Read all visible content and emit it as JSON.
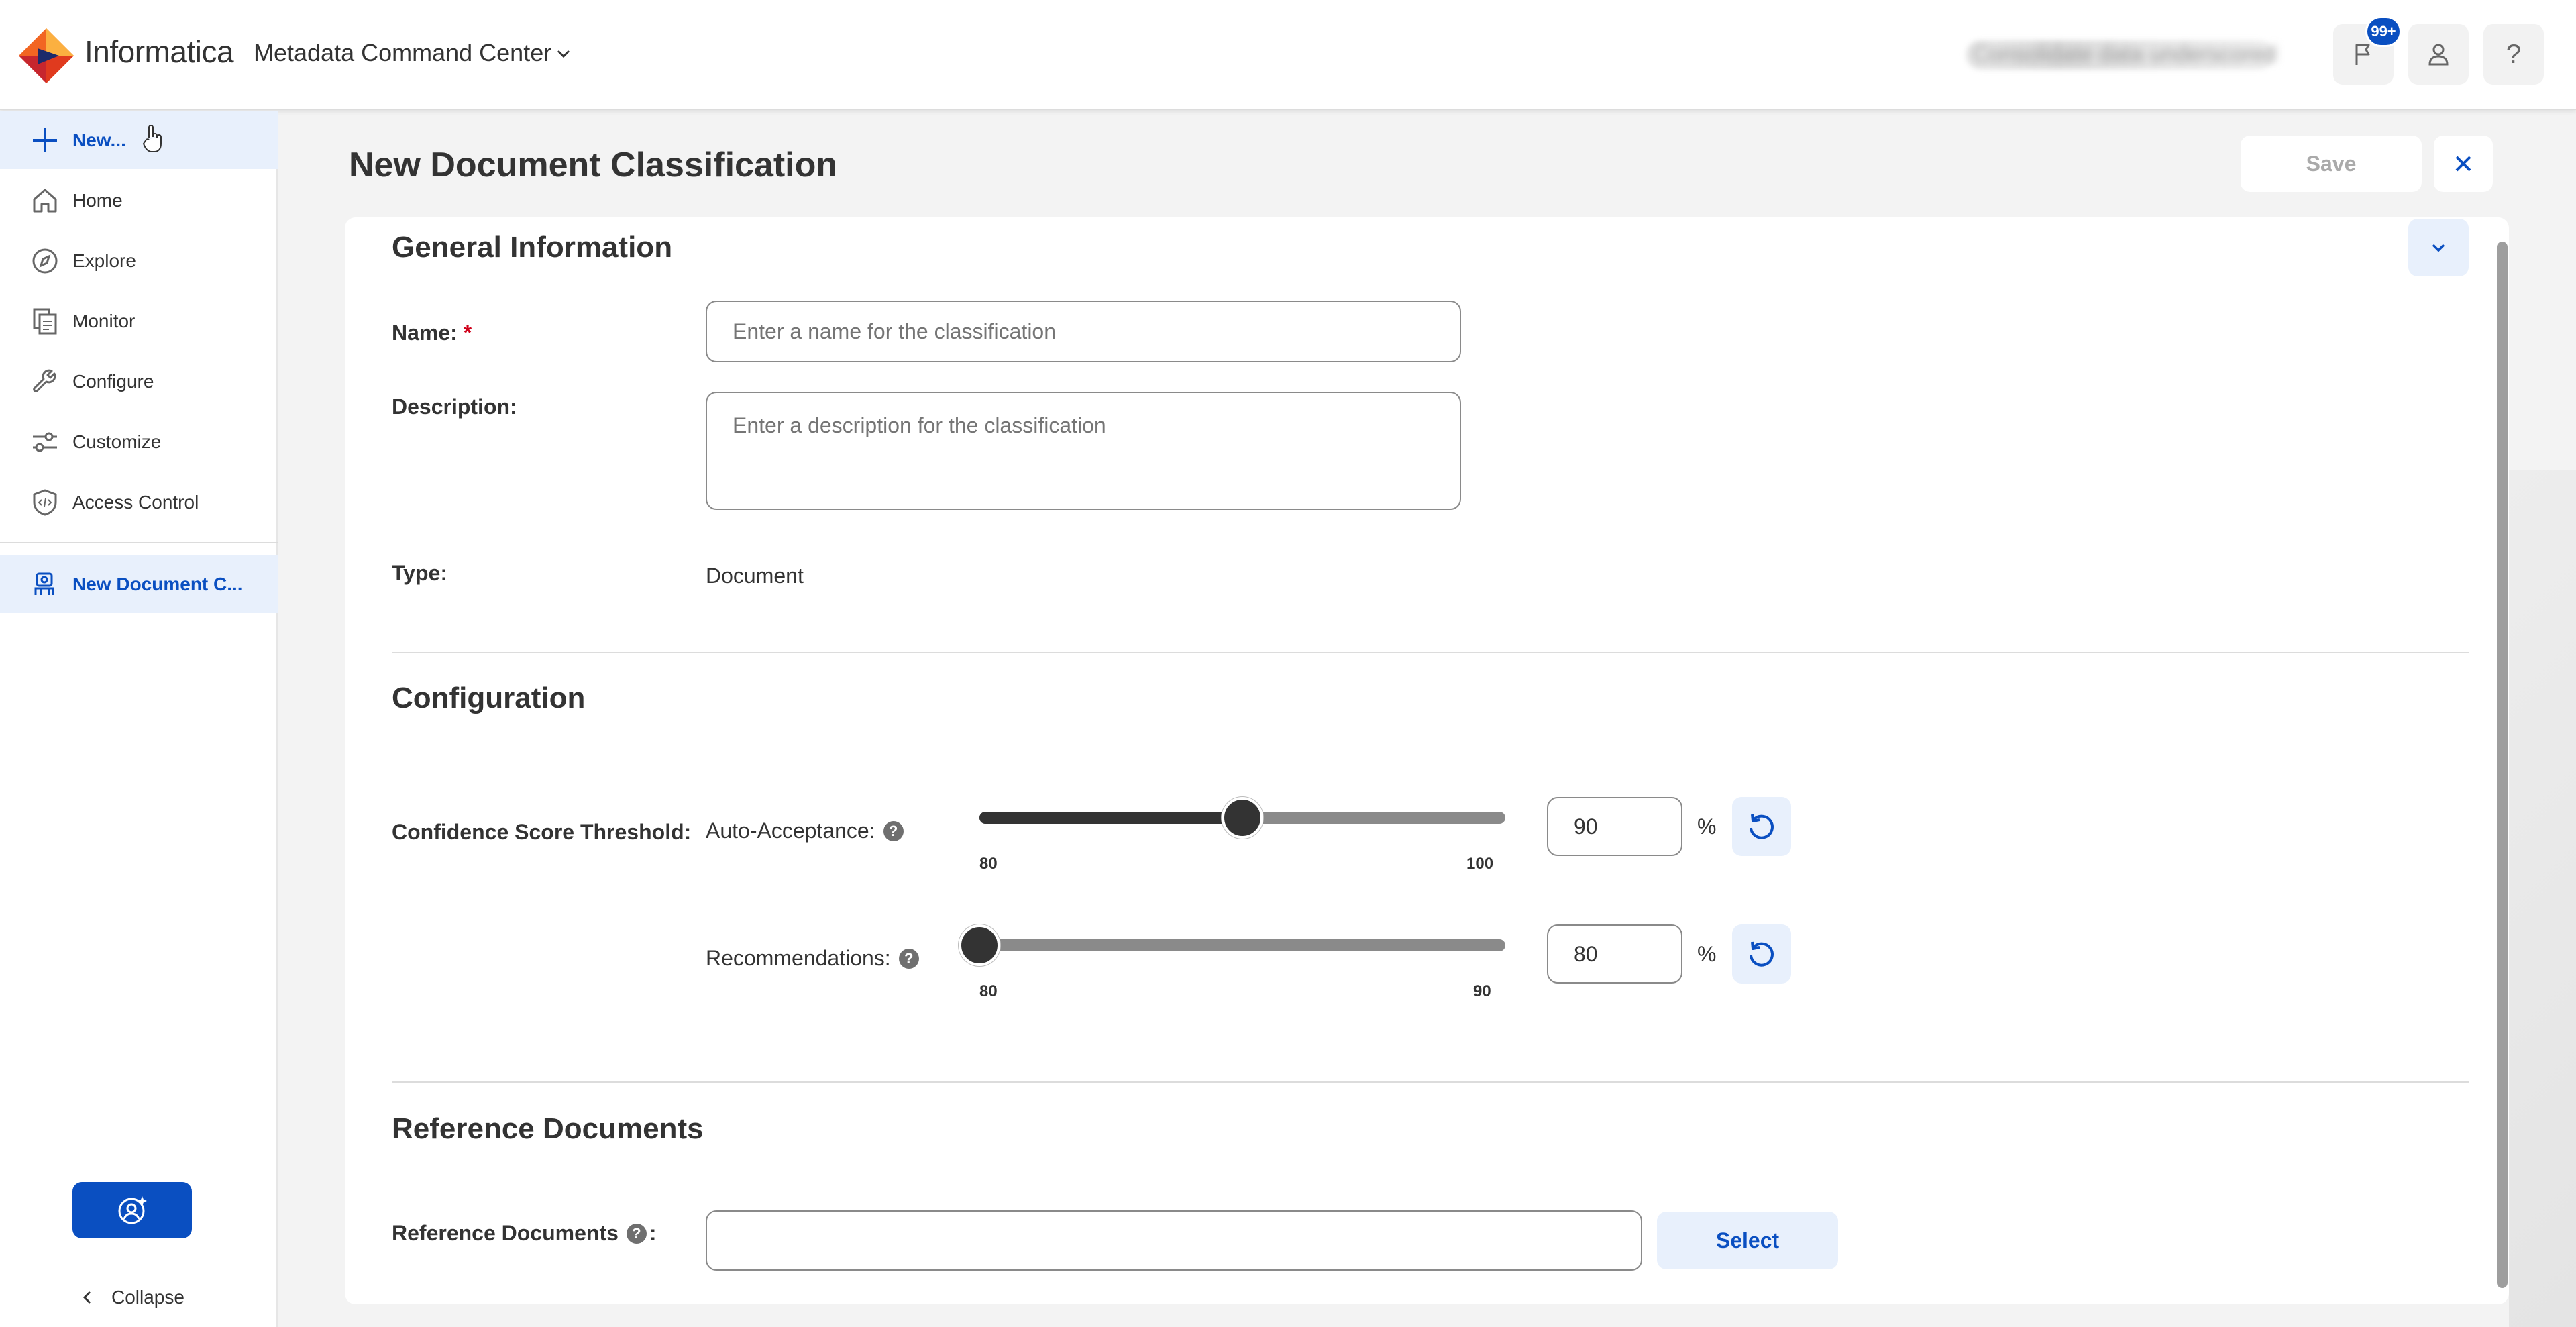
{
  "header": {
    "brand": "Informatica",
    "app_name": "Metadata Command Center",
    "user_menu_label": "Consolidate data underscored",
    "notifications_badge": "99+",
    "help_label": "?"
  },
  "sidebar": {
    "items": [
      {
        "label": "New...",
        "icon": "plus-icon"
      },
      {
        "label": "Home",
        "icon": "home-icon"
      },
      {
        "label": "Explore",
        "icon": "compass-icon"
      },
      {
        "label": "Monitor",
        "icon": "documents-icon"
      },
      {
        "label": "Configure",
        "icon": "wrench-icon"
      },
      {
        "label": "Customize",
        "icon": "sliders-icon"
      },
      {
        "label": "Access Control",
        "icon": "shield-icon"
      },
      {
        "label": "New Document C...",
        "icon": "classification-icon"
      }
    ],
    "collapse_label": "Collapse"
  },
  "page": {
    "title": "New Document Classification",
    "save_label": "Save"
  },
  "general": {
    "title": "General Information",
    "name_label": "Name:",
    "name_required": "*",
    "name_placeholder": "Enter a name for the classification",
    "description_label": "Description:",
    "description_placeholder": "Enter a description for the classification",
    "type_label": "Type:",
    "type_value": "Document"
  },
  "configuration": {
    "title": "Configuration",
    "threshold_label": "Confidence Score Threshold:",
    "auto_acceptance": {
      "label": "Auto-Acceptance:",
      "min": "80",
      "max": "100",
      "value": "90",
      "fraction": 0.5
    },
    "recommendations": {
      "label": "Recommendations:",
      "min": "80",
      "max": "90",
      "value": "80",
      "fraction": 0.0
    },
    "unit": "%"
  },
  "reference": {
    "title": "Reference Documents",
    "label": "Reference Documents",
    "label_suffix": ":",
    "value": "",
    "select_label": "Select"
  },
  "colors": {
    "accent": "#0a4fc1",
    "logo_orange": "#f26522",
    "required": "#d0021b"
  }
}
